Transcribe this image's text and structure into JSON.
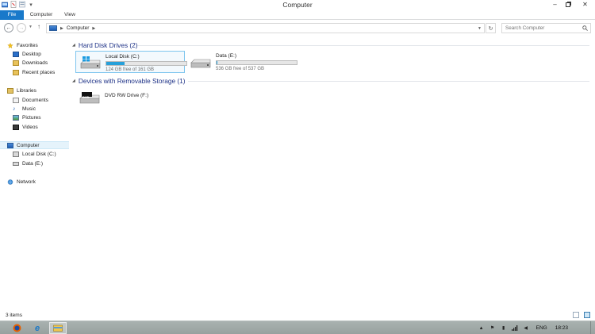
{
  "window": {
    "title": "Computer"
  },
  "ribbon": {
    "tabs": [
      "File",
      "Computer",
      "View"
    ]
  },
  "address": {
    "crumbs": [
      "Computer"
    ]
  },
  "search": {
    "placeholder": "Search Computer"
  },
  "navpane": {
    "favorites": {
      "label": "Favorites",
      "items": [
        "Desktop",
        "Downloads",
        "Recent places"
      ]
    },
    "libraries": {
      "label": "Libraries",
      "items": [
        "Documents",
        "Music",
        "Pictures",
        "Videos"
      ]
    },
    "computer": {
      "label": "Computer",
      "items": [
        "Local Disk (C:)",
        "Data (E:)"
      ]
    },
    "network": {
      "label": "Network"
    }
  },
  "groups": {
    "hdd": {
      "title": "Hard Disk Drives (2)",
      "drives": [
        {
          "name": "Local Disk (C:)",
          "sub": "124 GB free of 161 GB",
          "used_fraction": 0.23
        },
        {
          "name": "Data (E:)",
          "sub": "536 GB free of 537 GB",
          "used_fraction": 0.002
        }
      ]
    },
    "removable": {
      "title": "Devices with Removable Storage (1)",
      "drives": [
        {
          "name": "DVD RW Drive (F:)",
          "badge": "DVD"
        }
      ]
    }
  },
  "status": {
    "items": "3 items"
  },
  "taskbar": {
    "lang": "ENG",
    "time": "18:23"
  },
  "colors": {
    "accent": "#1979ca",
    "selection": "#e5f3fb",
    "bar_fill": "#26a0da",
    "group_title": "#1e3287"
  }
}
